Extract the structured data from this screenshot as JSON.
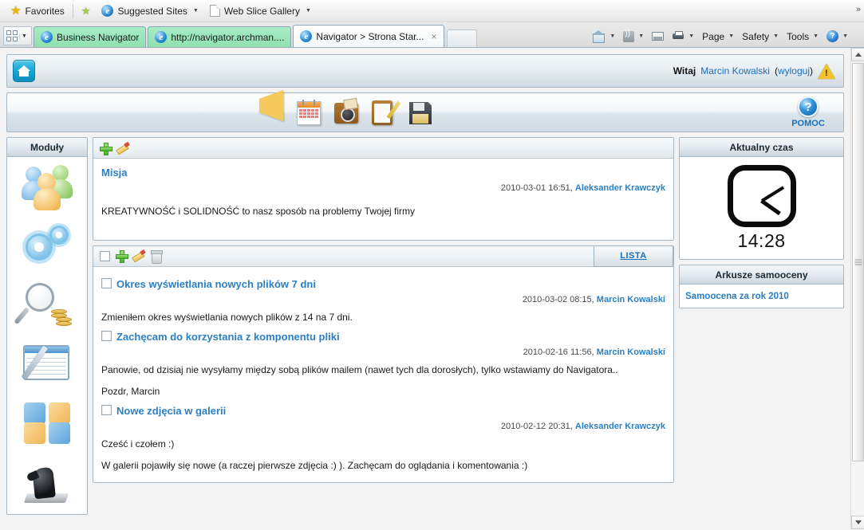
{
  "browser": {
    "favorites_label": "Favorites",
    "links": [
      {
        "label": "Suggested Sites",
        "icon": "ie-icon",
        "has_caret": true
      },
      {
        "label": "Web Slice Gallery",
        "icon": "page-icon",
        "has_caret": true
      }
    ],
    "tabs": [
      {
        "label": "Business Navigator",
        "state": "grouped"
      },
      {
        "label": "http://navigator.archman....",
        "state": "grouped"
      },
      {
        "label": "Navigator > Strona Star...",
        "state": "active",
        "close": "×"
      }
    ],
    "command_bar": [
      {
        "label": "",
        "icon": "home-icon",
        "caret": true
      },
      {
        "label": "",
        "icon": "rss-icon",
        "caret": true
      },
      {
        "label": "",
        "icon": "mail-icon",
        "caret": false
      },
      {
        "label": "",
        "icon": "print-icon",
        "caret": true
      },
      {
        "label": "Page",
        "icon": "",
        "caret": true
      },
      {
        "label": "Safety",
        "icon": "",
        "caret": true
      },
      {
        "label": "Tools",
        "icon": "",
        "caret": true
      },
      {
        "label": "",
        "icon": "help-icon",
        "caret": true
      }
    ],
    "overflow_chevron": "»"
  },
  "app": {
    "header": {
      "home_icon": "home-icon",
      "greeting": "Witaj",
      "user_name": "Marcin Kowalski",
      "logout_open": "(",
      "logout_label": "wyloguj",
      "logout_close": ")",
      "warning_icon": "warning-triangle-icon"
    },
    "toolbar": {
      "items": [
        {
          "name": "megaphone-icon"
        },
        {
          "name": "calendar-icon"
        },
        {
          "name": "camera-icon"
        },
        {
          "name": "clipboard-icon"
        },
        {
          "name": "floppy-disk-icon"
        }
      ],
      "help": {
        "glyph": "?",
        "label": "POMOC"
      }
    }
  },
  "sidebar": {
    "title": "Moduły",
    "items": [
      {
        "name": "users-icon"
      },
      {
        "name": "gears-icon"
      },
      {
        "name": "magnifier-coins-icon"
      },
      {
        "name": "spreadsheet-pen-icon"
      },
      {
        "name": "puzzle-icon"
      },
      {
        "name": "chess-knight-icon"
      }
    ]
  },
  "mission": {
    "tools": [
      {
        "name": "add-icon"
      },
      {
        "name": "edit-icon"
      }
    ],
    "title": "Misja",
    "meta_date": "2010-03-01 16:51,",
    "meta_author": "Aleksander Krawczyk",
    "text": "KREATYWNOŚĆ i SOLIDNOŚĆ to nasz sposób na problemy Twojej firmy"
  },
  "news": {
    "tools": [
      {
        "name": "select-all-checkbox"
      },
      {
        "name": "add-icon"
      },
      {
        "name": "edit-icon"
      },
      {
        "name": "delete-icon"
      }
    ],
    "list_button": "LISTA",
    "items": [
      {
        "title": "Okres wyświetlania nowych plików 7 dni",
        "meta_date": "2010-03-02 08:15,",
        "meta_author": "Marcin Kowalski",
        "paragraphs": [
          "Zmieniłem okres wyświetlania nowych plików z 14 na 7 dni."
        ]
      },
      {
        "title": "Zachęcam do korzystania z komponentu pliki",
        "meta_date": "2010-02-16 11:56,",
        "meta_author": "Marcin Kowalski",
        "paragraphs": [
          "Panowie, od dzisiaj nie wysyłamy między sobą plików mailem (nawet tych dla dorosłych), tylko wstawiamy do Navigatora..",
          "Pozdr, Marcin"
        ]
      },
      {
        "title": "Nowe zdjęcia w galerii",
        "meta_date": "2010-02-12 20:31,",
        "meta_author": "Aleksander Krawczyk",
        "paragraphs": [
          "Cześć i czołem :)",
          "W galerii pojawiły się nowe (a raczej pierwsze zdjęcia :) ). Zachęcam do oglądania i komentowania :)"
        ]
      }
    ]
  },
  "clock": {
    "title": "Aktualny czas",
    "time": "14:28"
  },
  "selfeval": {
    "title": "Arkusze samooceny",
    "link": "Samoocena za rok 2010"
  },
  "colors": {
    "link_blue": "#2b7fc4",
    "tab_green": "#8fe0b0",
    "panel_border": "#a6b8c6",
    "home_teal": "#17a6d4"
  }
}
